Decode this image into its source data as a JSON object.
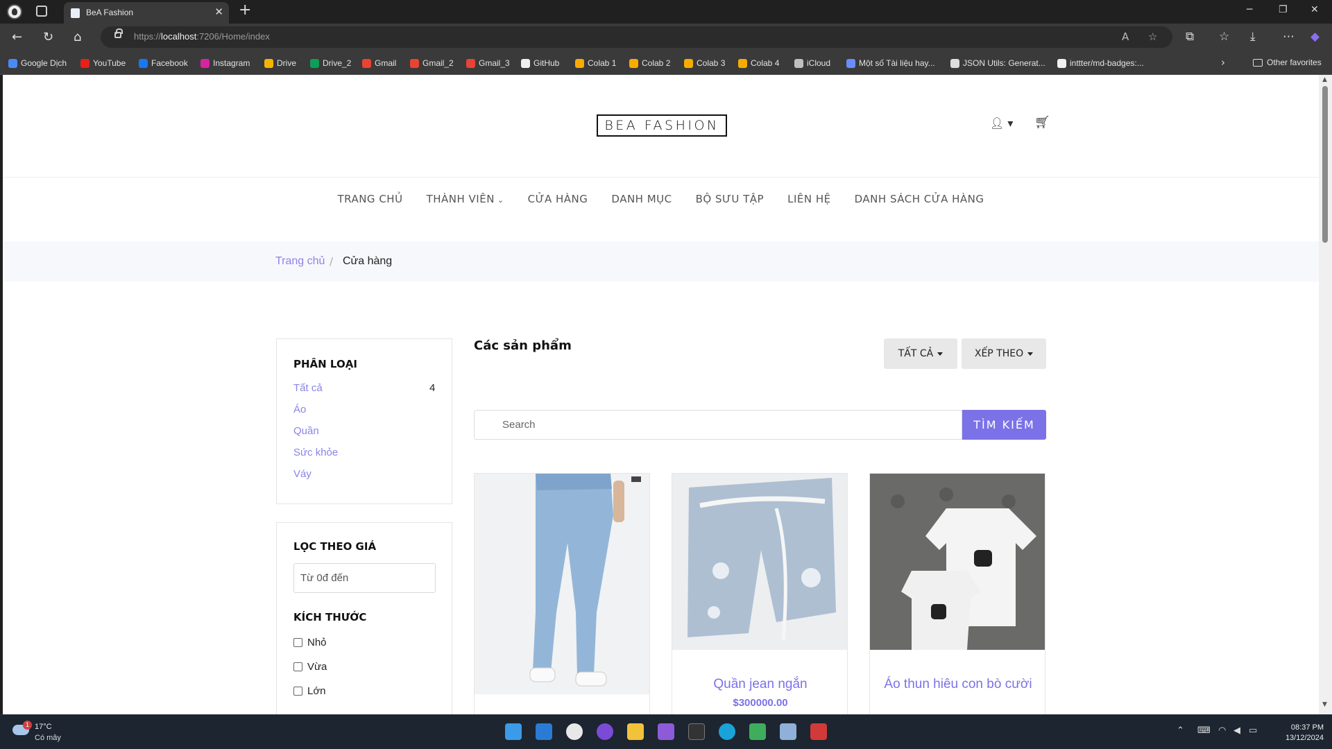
{
  "browser": {
    "tab_title": "BeA Fashion",
    "url_prefix": "https://",
    "url_host": "localhost",
    "url_rest": ":7206/Home/index",
    "bookmarks": [
      {
        "label": "Google Dịch",
        "color": "#4a8af4"
      },
      {
        "label": "YouTube",
        "color": "#e62117"
      },
      {
        "label": "Facebook",
        "color": "#1877f2"
      },
      {
        "label": "Instagram",
        "color": "#d6249f"
      },
      {
        "label": "Drive",
        "color": "#f4b400"
      },
      {
        "label": "Drive_2",
        "color": "#0f9d58"
      },
      {
        "label": "Gmail",
        "color": "#ea4335"
      },
      {
        "label": "Gmail_2",
        "color": "#ea4335"
      },
      {
        "label": "Gmail_3",
        "color": "#ea4335"
      },
      {
        "label": "GitHub",
        "color": "#f0f0f0"
      },
      {
        "label": "Colab 1",
        "color": "#f9ab00"
      },
      {
        "label": "Colab 2",
        "color": "#f9ab00"
      },
      {
        "label": "Colab 3",
        "color": "#f9ab00"
      },
      {
        "label": "Colab 4",
        "color": "#f9ab00"
      },
      {
        "label": "iCloud",
        "color": "#c0c0c0"
      },
      {
        "label": "Một số Tài liệu hay...",
        "color": "#6b8cff"
      },
      {
        "label": "JSON Utils: Generat...",
        "color": "#dddddd"
      },
      {
        "label": "inttter/md-badges:...",
        "color": "#f0f0f0"
      }
    ],
    "other_favorites": "Other favorites"
  },
  "site": {
    "logo": "BEA FASHION",
    "nav": [
      "TRANG CHỦ",
      "THÀNH VIÊN",
      "CỬA HÀNG",
      "DANH MỤC",
      "BỘ SƯU TẬP",
      "LIÊN HỆ",
      "DANH SÁCH CỬA HÀNG"
    ],
    "breadcrumb": {
      "home": "Trang chủ",
      "separator": "/",
      "current": "Cửa hàng"
    },
    "sidebar": {
      "category_title": "PHÂN LOẠI",
      "categories": [
        {
          "label": "Tất cả",
          "count": "4"
        },
        {
          "label": "Áo",
          "count": ""
        },
        {
          "label": "Quần",
          "count": ""
        },
        {
          "label": "Sức khỏe",
          "count": ""
        },
        {
          "label": "Váy",
          "count": ""
        }
      ],
      "price_title": "LỌC THEO GIÁ",
      "price_placeholder": "Từ 0đ đến",
      "size_title": "KÍCH THƯỚC",
      "sizes": [
        "Nhỏ",
        "Vừa",
        "Lớn"
      ]
    },
    "main": {
      "title": "Các sản phẩm",
      "filter_all": "TẤT CẢ",
      "sort_by": "XẾP THEO",
      "search_placeholder": "Search",
      "search_button": "TÌM KIẾM",
      "products": [
        {
          "name": "",
          "price": ""
        },
        {
          "name": "Quần jean ngắn",
          "price": "$300000.00"
        },
        {
          "name": "Áo thun hiêu con bò cười",
          "price": ""
        }
      ]
    }
  },
  "taskbar": {
    "temperature": "17°C",
    "condition": "Có mây",
    "weather_badge": "1",
    "time": "08:37 PM",
    "date": "13/12/2024"
  },
  "colors": {
    "accent": "#7b72e8",
    "link": "#8a84e8"
  }
}
